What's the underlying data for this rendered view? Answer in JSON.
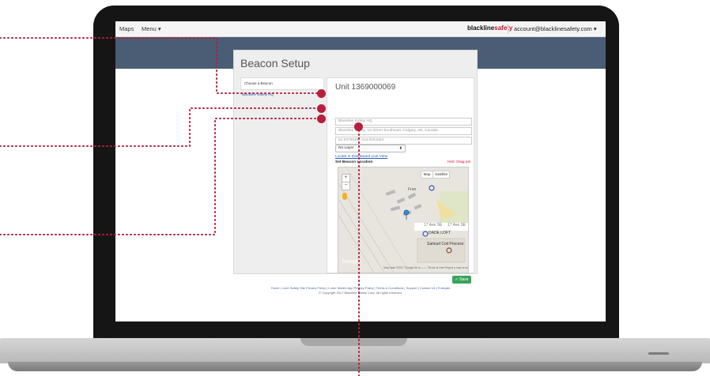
{
  "navbar": {
    "maps_label": "Maps",
    "menu_label": "Menu ▾",
    "brand_prefix": "blackline",
    "brand_suffix": "safety",
    "account_label": "account@blacklinesafety.com ▾"
  },
  "page": {
    "title": "Beacon Setup",
    "left_card_label": "Choose a Beacon",
    "left_link": "Blackline Safety HQ",
    "unit_title": "Unit 1369000069",
    "fields": [
      {
        "placeholder": "Blackline Safety HQ"
      },
      {
        "placeholder": "Blackline Safety, 13 Street Southeast, Calgary, AB, Canada"
      },
      {
        "placeholder": "51.0379526, -114.0341663"
      }
    ],
    "layer_select": "No Layer",
    "dashboard_link": "Locate in Dashboard Live View",
    "set_location_label": "Set Beacon Location",
    "hint": "Hint: Drag pin",
    "save_label": "✓ Save"
  },
  "map": {
    "map_btn": "Map",
    "satellite_btn": "Satellite",
    "zoom_in": "+",
    "zoom_out": "−",
    "label_frank": "Fran",
    "label_loft": "DADE LOFT",
    "label_17ave_1": "17 Ave SE",
    "label_17ave_2": "17 Ave SE",
    "label_samuel": "Samuel Coil Process",
    "google_label": "Google",
    "footer_text": "Map data ©2017 Google   50 m ——   Terms of Use   Report a map error"
  },
  "footer": {
    "links": "Home | Lone Safety Site Privacy Policy | Loner Mobile App Privacy Policy | Terms & Conditions | Support | Contact Us | Français",
    "copyright": "© Copyright 2017 Blackline Safety Corp. All rights reserved."
  },
  "colors": {
    "accent": "#b5203c",
    "header_band": "#4a5d75",
    "save_green": "#3aa45a"
  }
}
